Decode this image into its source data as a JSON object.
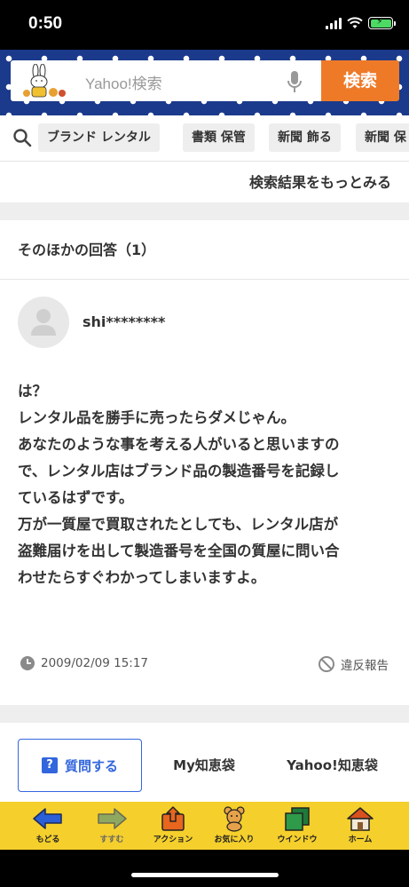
{
  "status_bar": {
    "time": "0:50"
  },
  "search": {
    "placeholder": "Yahoo!検索",
    "button_label": "検索"
  },
  "suggestions": [
    "ブランド レンタル",
    "書類 保管",
    "新聞 飾る",
    "新聞 保"
  ],
  "more_results_label": "検索結果をもっとみる",
  "answers_section": {
    "title": "そのほかの回答（1）",
    "answer": {
      "user": "shi********",
      "lines": [
        "は？",
        "レンタル品を勝手に売ったらダメじゃん。",
        "あなたのような事を考える人がいると思いますの",
        "で、レンタル店はブランド品の製造番号を記録し",
        "ているはずです。",
        "万が一質屋で買取されたとしても、レンタル店が",
        "盗難届けを出して製造番号を全国の質屋に問い合",
        "わせたらすぐわかってしまいますよ。"
      ],
      "date": "2009/02/09 15:17",
      "report_label": "違反報告"
    }
  },
  "bottom_tabs": {
    "ask": "質問する",
    "my": "My知恵袋",
    "home": "Yahoo!知恵袋"
  },
  "toolbar": {
    "back": "もどる",
    "forward": "すすむ",
    "action": "アクション",
    "favorites": "お気に入り",
    "window": "ウインドウ",
    "home": "ホーム"
  },
  "colors": {
    "header_blue": "#1b3a8c",
    "search_orange": "#ee7a28",
    "toolbar_yellow": "#f5cf2c",
    "ask_blue": "#3366dd"
  }
}
